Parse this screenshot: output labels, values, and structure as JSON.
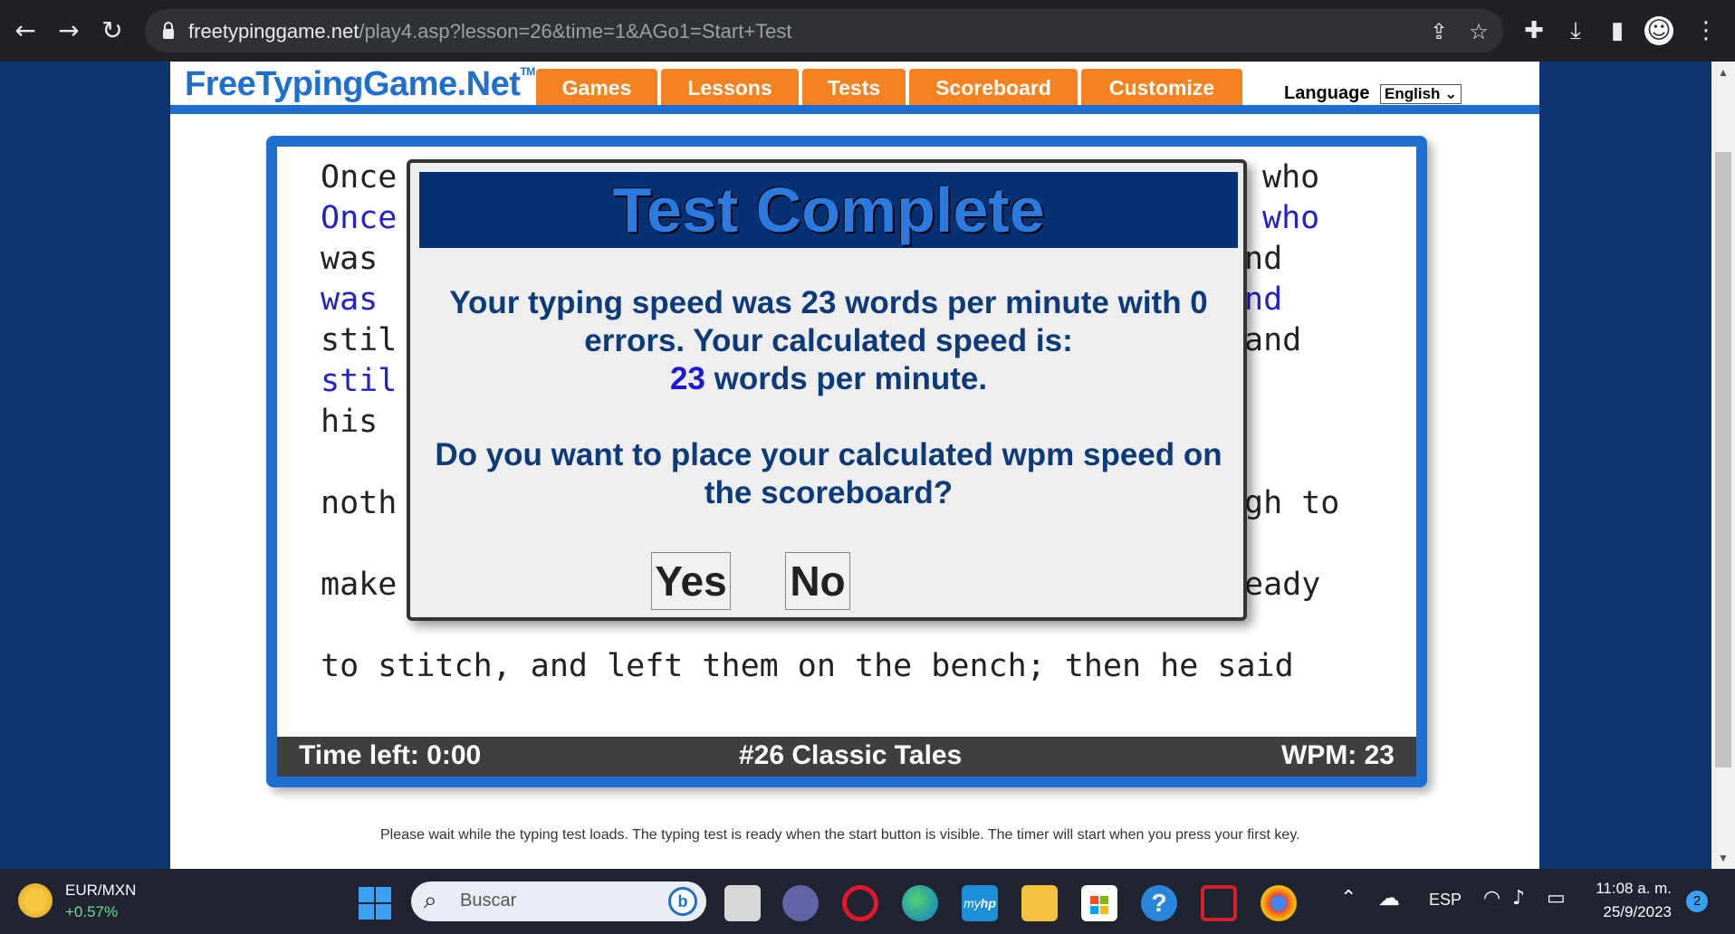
{
  "browser": {
    "url_host": "freetypinggame.net",
    "url_path": "/play4.asp?lesson=26&time=1&AGo1=Start+Test"
  },
  "site": {
    "logo": "FreeTypingGame.Net",
    "logo_tm": "TM",
    "tabs": [
      "Games",
      "Lessons",
      "Tests",
      "Scoreboard",
      "Customize"
    ],
    "language_label": "Language",
    "language_value": "English"
  },
  "typing": {
    "lines": [
      {
        "left": "Once",
        "right": "who",
        "typed": false
      },
      {
        "left": "Once",
        "right": "who",
        "typed": true
      },
      {
        "left": "was",
        "right": "nd",
        "typed": false
      },
      {
        "left": "was",
        "right": "nd",
        "typed": true
      },
      {
        "left": "stil",
        "right": "and",
        "typed": false
      },
      {
        "left": "stil",
        "right": "",
        "typed": true
      },
      {
        "left": "his",
        "right": "",
        "typed": false
      },
      {
        "left": "noth",
        "right": "gh to",
        "typed": false
      },
      {
        "left": "make",
        "right": "eady",
        "typed": false
      },
      {
        "left": "to stitch, and left them on the bench; then he said",
        "right": "",
        "typed": false
      }
    ],
    "status": {
      "time_left": "Time left: 0:00",
      "lesson": "#26 Classic Tales",
      "wpm": "WPM: 23"
    },
    "footer_note": "Please wait while the typing test loads. The typing test is ready when the start button is visible. The timer will start when you press your first key."
  },
  "modal": {
    "title": "Test Complete",
    "result_line1": "Your typing speed was 23 words per minute with 0",
    "result_line2": "errors. Your calculated speed is:",
    "calc_speed": "23",
    "calc_suffix": " words per minute.",
    "question_line1": "Do you want to place your calculated wpm speed on",
    "question_line2": "the scoreboard?",
    "yes_label": "Yes",
    "no_label": "No"
  },
  "taskbar": {
    "ticker_symbol": "EUR/MXN",
    "ticker_change": "+0.57%",
    "search_placeholder": "Buscar",
    "language": "ESP",
    "time": "11:08 a. m.",
    "date": "25/9/2023",
    "notification_count": "2"
  },
  "colors": {
    "accent_blue": "#1f6fd1",
    "tab_orange": "#f58220",
    "page_bg": "#0b3470"
  }
}
